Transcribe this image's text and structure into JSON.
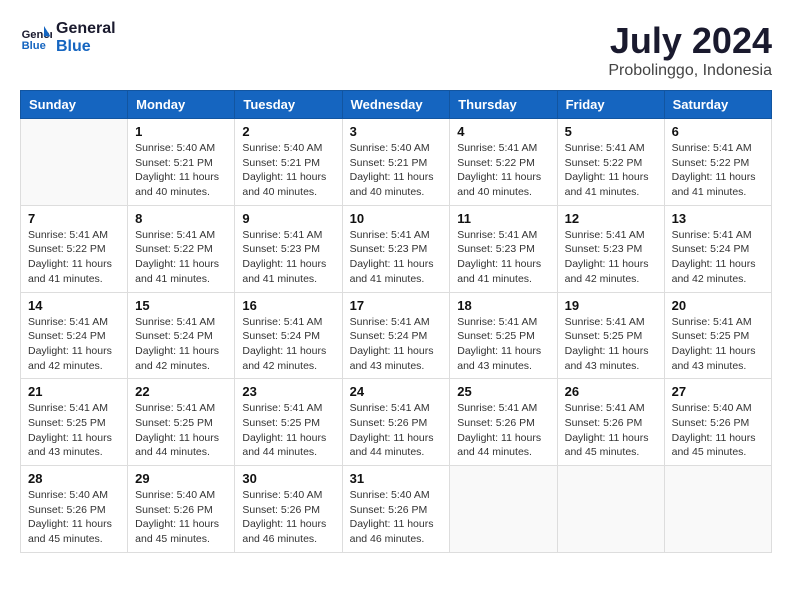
{
  "header": {
    "logo_line1": "General",
    "logo_line2": "Blue",
    "month_year": "July 2024",
    "location": "Probolinggo, Indonesia"
  },
  "weekdays": [
    "Sunday",
    "Monday",
    "Tuesday",
    "Wednesday",
    "Thursday",
    "Friday",
    "Saturday"
  ],
  "weeks": [
    [
      {
        "day": "",
        "info": ""
      },
      {
        "day": "1",
        "info": "Sunrise: 5:40 AM\nSunset: 5:21 PM\nDaylight: 11 hours\nand 40 minutes."
      },
      {
        "day": "2",
        "info": "Sunrise: 5:40 AM\nSunset: 5:21 PM\nDaylight: 11 hours\nand 40 minutes."
      },
      {
        "day": "3",
        "info": "Sunrise: 5:40 AM\nSunset: 5:21 PM\nDaylight: 11 hours\nand 40 minutes."
      },
      {
        "day": "4",
        "info": "Sunrise: 5:41 AM\nSunset: 5:22 PM\nDaylight: 11 hours\nand 40 minutes."
      },
      {
        "day": "5",
        "info": "Sunrise: 5:41 AM\nSunset: 5:22 PM\nDaylight: 11 hours\nand 41 minutes."
      },
      {
        "day": "6",
        "info": "Sunrise: 5:41 AM\nSunset: 5:22 PM\nDaylight: 11 hours\nand 41 minutes."
      }
    ],
    [
      {
        "day": "7",
        "info": "Sunrise: 5:41 AM\nSunset: 5:22 PM\nDaylight: 11 hours\nand 41 minutes."
      },
      {
        "day": "8",
        "info": "Sunrise: 5:41 AM\nSunset: 5:22 PM\nDaylight: 11 hours\nand 41 minutes."
      },
      {
        "day": "9",
        "info": "Sunrise: 5:41 AM\nSunset: 5:23 PM\nDaylight: 11 hours\nand 41 minutes."
      },
      {
        "day": "10",
        "info": "Sunrise: 5:41 AM\nSunset: 5:23 PM\nDaylight: 11 hours\nand 41 minutes."
      },
      {
        "day": "11",
        "info": "Sunrise: 5:41 AM\nSunset: 5:23 PM\nDaylight: 11 hours\nand 41 minutes."
      },
      {
        "day": "12",
        "info": "Sunrise: 5:41 AM\nSunset: 5:23 PM\nDaylight: 11 hours\nand 42 minutes."
      },
      {
        "day": "13",
        "info": "Sunrise: 5:41 AM\nSunset: 5:24 PM\nDaylight: 11 hours\nand 42 minutes."
      }
    ],
    [
      {
        "day": "14",
        "info": "Sunrise: 5:41 AM\nSunset: 5:24 PM\nDaylight: 11 hours\nand 42 minutes."
      },
      {
        "day": "15",
        "info": "Sunrise: 5:41 AM\nSunset: 5:24 PM\nDaylight: 11 hours\nand 42 minutes."
      },
      {
        "day": "16",
        "info": "Sunrise: 5:41 AM\nSunset: 5:24 PM\nDaylight: 11 hours\nand 42 minutes."
      },
      {
        "day": "17",
        "info": "Sunrise: 5:41 AM\nSunset: 5:24 PM\nDaylight: 11 hours\nand 43 minutes."
      },
      {
        "day": "18",
        "info": "Sunrise: 5:41 AM\nSunset: 5:25 PM\nDaylight: 11 hours\nand 43 minutes."
      },
      {
        "day": "19",
        "info": "Sunrise: 5:41 AM\nSunset: 5:25 PM\nDaylight: 11 hours\nand 43 minutes."
      },
      {
        "day": "20",
        "info": "Sunrise: 5:41 AM\nSunset: 5:25 PM\nDaylight: 11 hours\nand 43 minutes."
      }
    ],
    [
      {
        "day": "21",
        "info": "Sunrise: 5:41 AM\nSunset: 5:25 PM\nDaylight: 11 hours\nand 43 minutes."
      },
      {
        "day": "22",
        "info": "Sunrise: 5:41 AM\nSunset: 5:25 PM\nDaylight: 11 hours\nand 44 minutes."
      },
      {
        "day": "23",
        "info": "Sunrise: 5:41 AM\nSunset: 5:25 PM\nDaylight: 11 hours\nand 44 minutes."
      },
      {
        "day": "24",
        "info": "Sunrise: 5:41 AM\nSunset: 5:26 PM\nDaylight: 11 hours\nand 44 minutes."
      },
      {
        "day": "25",
        "info": "Sunrise: 5:41 AM\nSunset: 5:26 PM\nDaylight: 11 hours\nand 44 minutes."
      },
      {
        "day": "26",
        "info": "Sunrise: 5:41 AM\nSunset: 5:26 PM\nDaylight: 11 hours\nand 45 minutes."
      },
      {
        "day": "27",
        "info": "Sunrise: 5:40 AM\nSunset: 5:26 PM\nDaylight: 11 hours\nand 45 minutes."
      }
    ],
    [
      {
        "day": "28",
        "info": "Sunrise: 5:40 AM\nSunset: 5:26 PM\nDaylight: 11 hours\nand 45 minutes."
      },
      {
        "day": "29",
        "info": "Sunrise: 5:40 AM\nSunset: 5:26 PM\nDaylight: 11 hours\nand 45 minutes."
      },
      {
        "day": "30",
        "info": "Sunrise: 5:40 AM\nSunset: 5:26 PM\nDaylight: 11 hours\nand 46 minutes."
      },
      {
        "day": "31",
        "info": "Sunrise: 5:40 AM\nSunset: 5:26 PM\nDaylight: 11 hours\nand 46 minutes."
      },
      {
        "day": "",
        "info": ""
      },
      {
        "day": "",
        "info": ""
      },
      {
        "day": "",
        "info": ""
      }
    ]
  ]
}
